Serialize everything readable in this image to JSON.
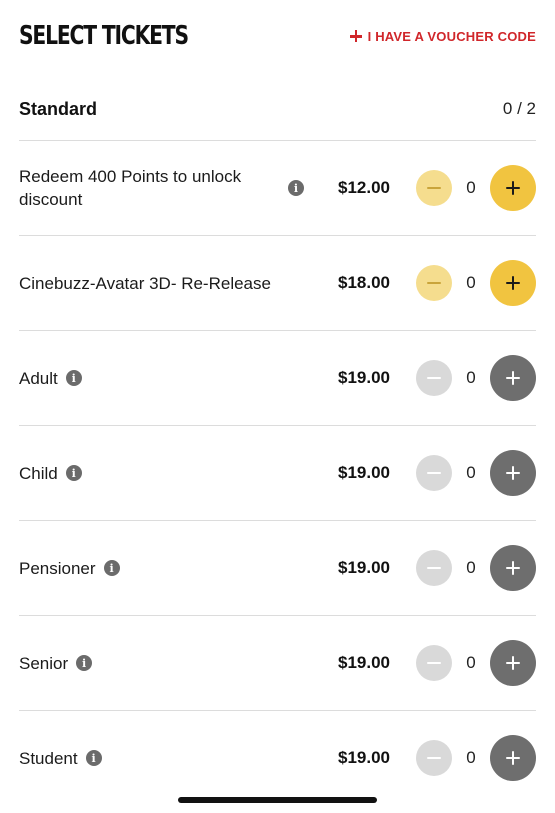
{
  "header": {
    "title": "SELECT TICKETS",
    "voucher_label": "I HAVE A VOUCHER CODE"
  },
  "section": {
    "title": "Standard",
    "count": "0 / 2"
  },
  "tickets": [
    {
      "name": "Redeem 400 Points to unlock discount",
      "price": "$12.00",
      "qty": "0",
      "style": "yellow",
      "info": true
    },
    {
      "name": "Cinebuzz-Avatar 3D- Re-Release",
      "price": "$18.00",
      "qty": "0",
      "style": "yellow",
      "info": false
    },
    {
      "name": "Adult",
      "price": "$19.00",
      "qty": "0",
      "style": "grey",
      "info": true
    },
    {
      "name": "Child",
      "price": "$19.00",
      "qty": "0",
      "style": "grey",
      "info": true
    },
    {
      "name": "Pensioner",
      "price": "$19.00",
      "qty": "0",
      "style": "grey",
      "info": true
    },
    {
      "name": "Senior",
      "price": "$19.00",
      "qty": "0",
      "style": "grey",
      "info": true
    },
    {
      "name": "Student",
      "price": "$19.00",
      "qty": "0",
      "style": "grey",
      "info": true
    }
  ],
  "icons": {
    "info": "i"
  },
  "colors": {
    "accent_red": "#d0262a",
    "yellow_plus": "#f1c440",
    "yellow_minus": "#f5dd8e",
    "grey_plus": "#6e6e6e",
    "grey_minus": "#d9d9d9"
  }
}
